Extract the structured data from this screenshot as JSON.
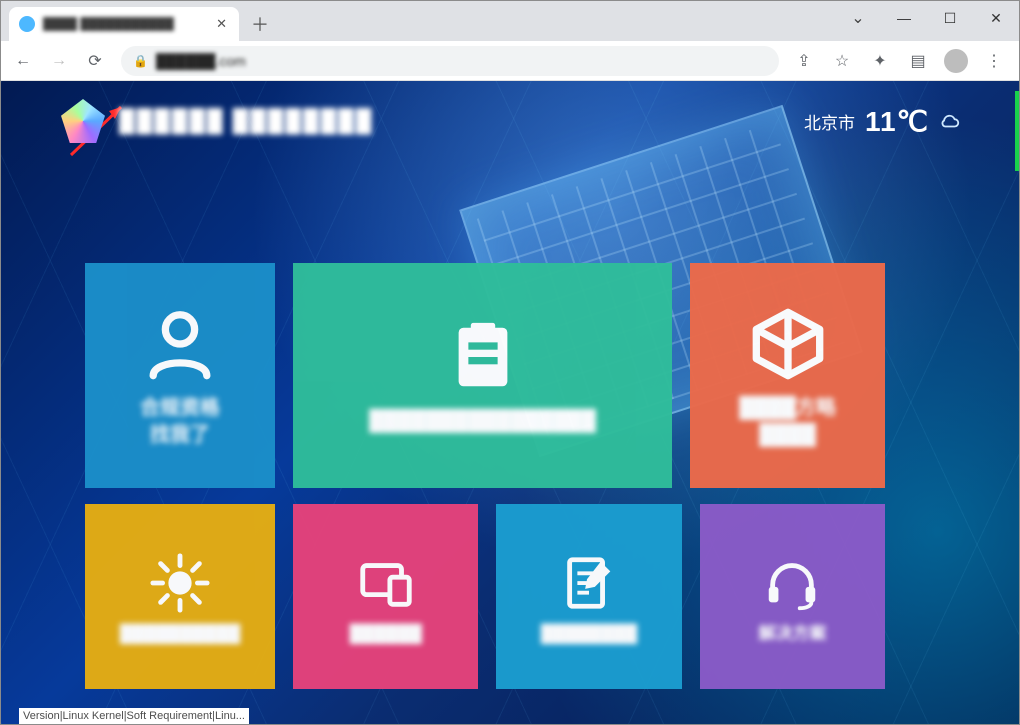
{
  "browser": {
    "tab_title": "████ ███████████",
    "url": "██████.com",
    "status_text": "Version|Linux Kernel|Soft Requirement|Linu..."
  },
  "page": {
    "site_title": "██████ ████████",
    "weather": {
      "city": "北京市",
      "temp": "11℃"
    }
  },
  "tiles": {
    "row1": [
      {
        "color": "t-blue",
        "label": "合规资格\n找我了",
        "icon": "person"
      },
      {
        "color": "t-green",
        "label": "████████████████",
        "icon": "card"
      },
      {
        "color": "t-orange",
        "label": "████方略\n████",
        "icon": "cube"
      }
    ],
    "row2": [
      {
        "color": "t-yellow",
        "label": "██████████",
        "icon": "spark"
      },
      {
        "color": "t-pink",
        "label": "██████",
        "icon": "device"
      },
      {
        "color": "t-teal",
        "label": "████████",
        "icon": "note"
      },
      {
        "color": "t-purple",
        "label": "解决方案",
        "icon": "headset"
      }
    ]
  }
}
